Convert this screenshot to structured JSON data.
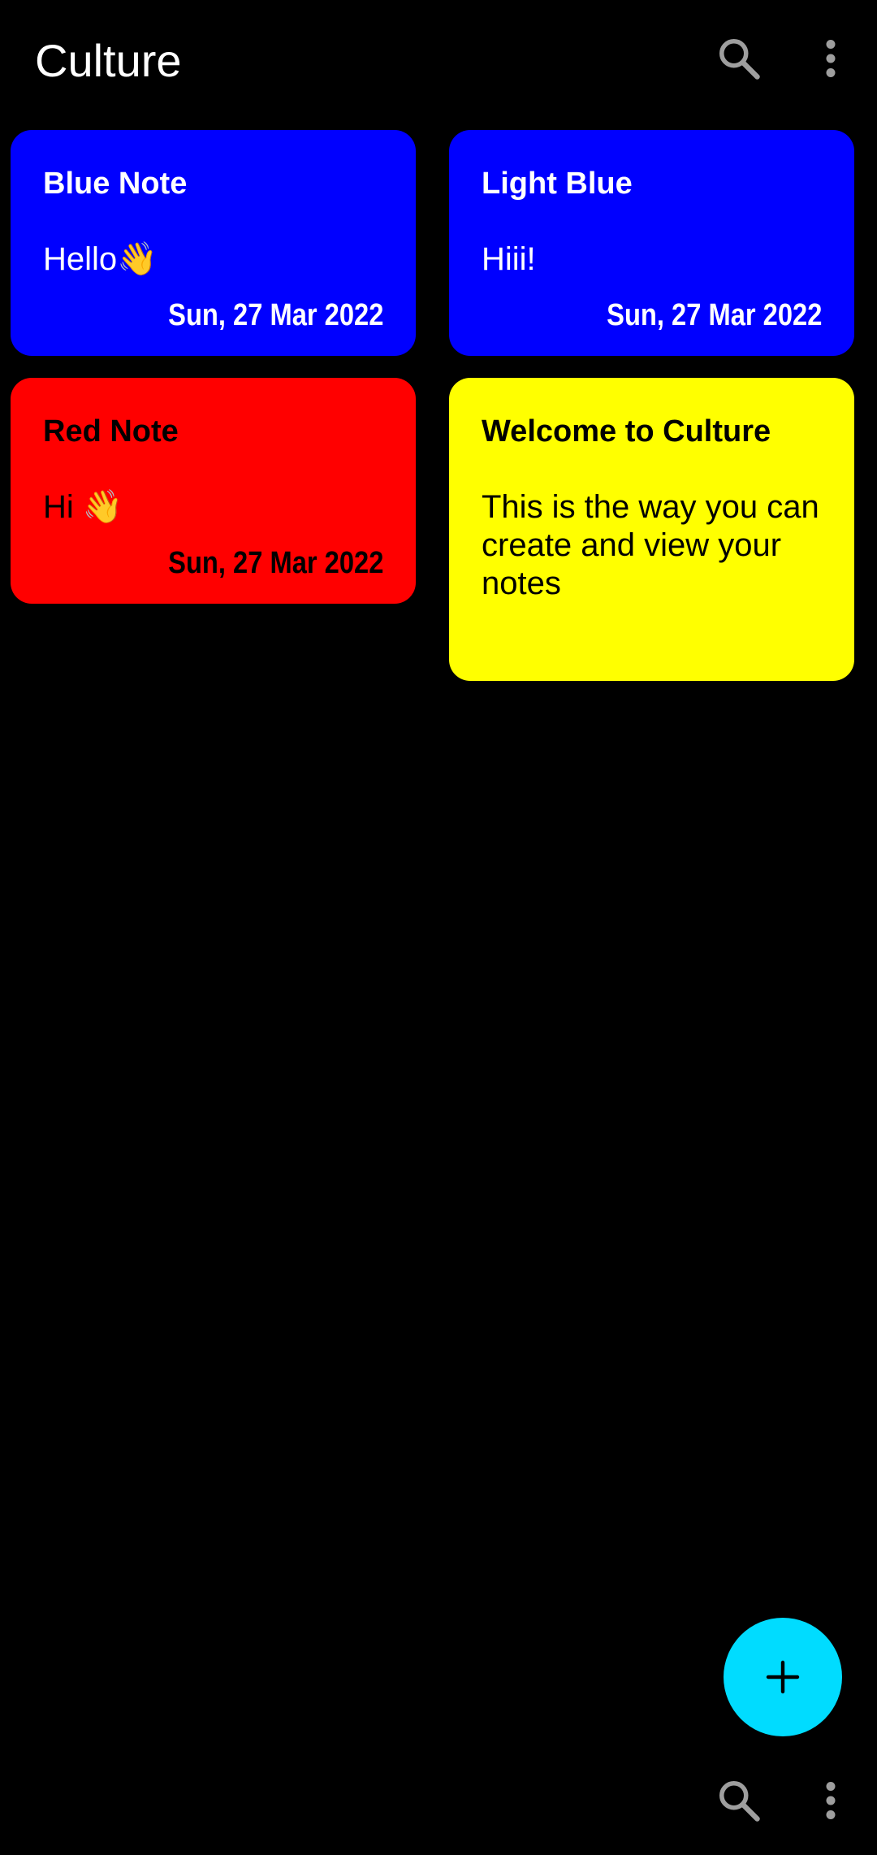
{
  "app": {
    "title": "Culture"
  },
  "toolbar": {
    "search_icon": "search-icon",
    "more_icon": "more-vertical-icon"
  },
  "notes": [
    {
      "title": "Blue Note",
      "body": "Hello👋",
      "date": "Sun, 27 Mar 2022",
      "color": "#0000ff",
      "text_color": "#ffffff"
    },
    {
      "title": "Light Blue",
      "body": "Hiii!",
      "date": "Sun, 27 Mar 2022",
      "color": "#0000ff",
      "text_color": "#ffffff"
    },
    {
      "title": "Red Note",
      "body": "Hi 👋",
      "date": "Sun, 27 Mar 2022",
      "color": "#ff0000",
      "text_color": "#000000"
    },
    {
      "title": "Welcome to Culture",
      "body": "This is the way you can create and view your notes",
      "date": "",
      "color": "#ffff00",
      "text_color": "#000000"
    }
  ],
  "fab": {
    "icon": "plus-icon",
    "color": "#00dcff"
  },
  "bottom_bar": {
    "search_icon": "search-icon",
    "more_icon": "more-vertical-icon"
  }
}
